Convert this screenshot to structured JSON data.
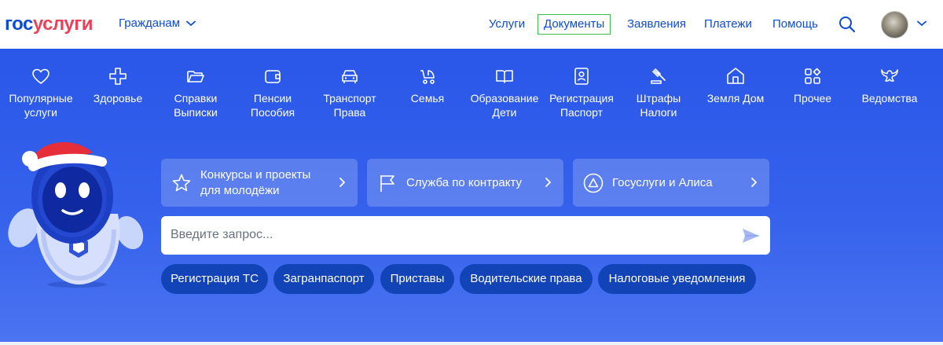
{
  "header": {
    "logo_part1": "гос",
    "logo_part2": "услуги",
    "for_citizens": "Гражданам",
    "nav": [
      {
        "label": "Услуги"
      },
      {
        "label": "Документы"
      },
      {
        "label": "Заявления"
      },
      {
        "label": "Платежи"
      },
      {
        "label": "Помощь"
      }
    ],
    "active_nav": "Документы"
  },
  "categories": [
    {
      "icon": "heart-icon",
      "line1": "Популярные",
      "line2": "услуги"
    },
    {
      "icon": "health-cross-icon",
      "line1": "Здоровье",
      "line2": ""
    },
    {
      "icon": "folder-icon",
      "line1": "Справки",
      "line2": "Выписки"
    },
    {
      "icon": "wallet-icon",
      "line1": "Пенсии",
      "line2": "Пособия"
    },
    {
      "icon": "car-icon",
      "line1": "Транспорт",
      "line2": "Права"
    },
    {
      "icon": "stroller-icon",
      "line1": "Семья",
      "line2": ""
    },
    {
      "icon": "book-icon",
      "line1": "Образование",
      "line2": "Дети"
    },
    {
      "icon": "passport-icon",
      "line1": "Регистрация",
      "line2": "Паспорт"
    },
    {
      "icon": "gavel-icon",
      "line1": "Штрафы",
      "line2": "Налоги"
    },
    {
      "icon": "house-icon",
      "line1": "Земля Дом",
      "line2": ""
    },
    {
      "icon": "tiles-icon",
      "line1": "Прочее",
      "line2": ""
    },
    {
      "icon": "eagle-icon",
      "line1": "Ведомства",
      "line2": ""
    }
  ],
  "promos": [
    {
      "icon": "star-icon",
      "line1": "Конкурсы и проекты",
      "line2": "для молодёжи"
    },
    {
      "icon": "flag-icon",
      "line1": "Служба по контракту",
      "line2": ""
    },
    {
      "icon": "alice-icon",
      "line1": "Госуслуги и Алиса",
      "line2": ""
    }
  ],
  "search": {
    "placeholder": "Введите запрос..."
  },
  "chips": [
    "Регистрация ТС",
    "Загранпаспорт",
    "Приставы",
    "Водительские права",
    "Налоговые уведомления"
  ],
  "colors": {
    "brand_blue": "#0d4cd3",
    "brand_red": "#ee3f58",
    "hero_bg": "#3561ec",
    "active_border": "#3dbd4b",
    "chip_bg": "#1244b8"
  }
}
